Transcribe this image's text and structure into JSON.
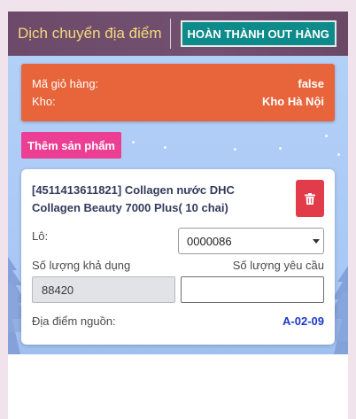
{
  "header": {
    "title": "Dịch chuyển địa điểm",
    "complete_button": "HOÀN THÀNH OUT HÀNG"
  },
  "info": {
    "cart_label": "Mã giỏ hàng:",
    "cart_value": "false",
    "warehouse_label": "Kho:",
    "warehouse_value": "Kho Hà Nội"
  },
  "add_product_button": "Thêm sản phẩm",
  "product": {
    "name": "[4511413611821] Collagen nước DHC Collagen Beauty 7000 Plus( 10 chai)",
    "lot_label": "Lô:",
    "lot_value": "0000086",
    "available_qty_label": "Số lượng khả dụng",
    "available_qty_value": "88420",
    "requested_qty_label": "Số lượng yêu cầu",
    "requested_qty_value": "",
    "source_location_label": "Địa điểm nguồn:",
    "source_location_value": "A-02-09"
  },
  "colors": {
    "header_bg": "#6d4a6a",
    "header_title": "#f5d97a",
    "complete_button_bg": "#0d8a8a",
    "info_card_bg": "#e8653c",
    "add_button_bg": "#ec3f93",
    "delete_button_bg": "#e23b4a",
    "source_value": "#1e38c8"
  },
  "icons": {
    "delete": "trash-icon",
    "lot_dropdown": "caret-down-icon"
  }
}
